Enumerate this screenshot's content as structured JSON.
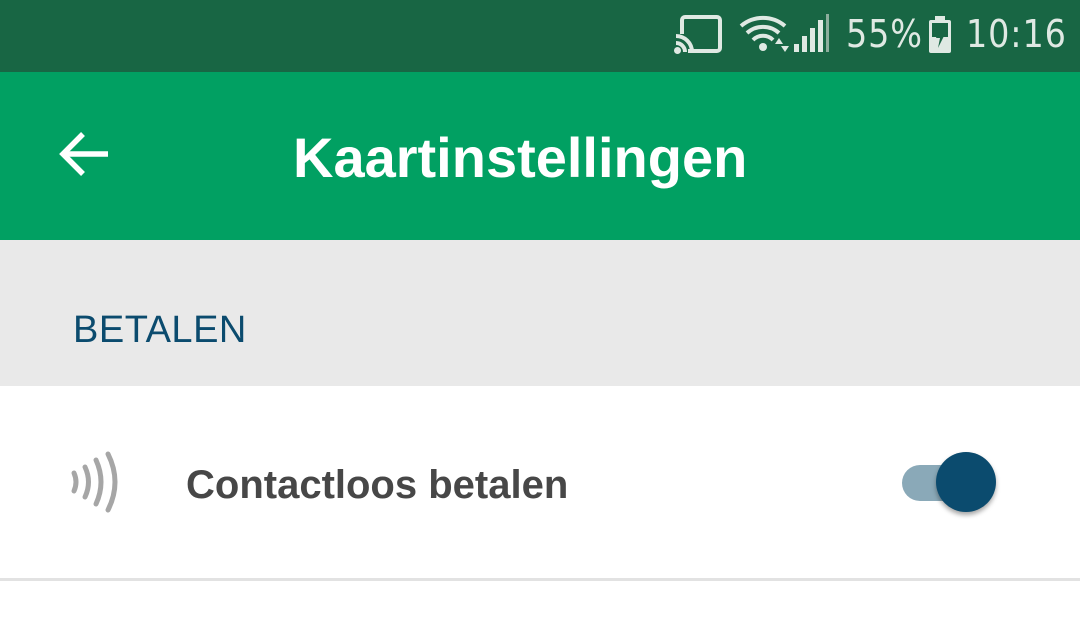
{
  "status_bar": {
    "battery_percent": "55%",
    "time": "10:16",
    "icons": [
      "cast-icon",
      "wifi-icon",
      "signal-icon",
      "battery-charging-icon"
    ]
  },
  "app_bar": {
    "title": "Kaartinstellingen",
    "back_icon": "arrow-left-icon"
  },
  "section": {
    "label": "BETALEN"
  },
  "setting": {
    "icon": "contactless-icon",
    "label": "Contactloos betalen",
    "toggle_on": true
  },
  "colors": {
    "status_bar": "#186644",
    "app_bar": "#01a062",
    "section_bg": "#e9e9e9",
    "section_text": "#0b4b6e",
    "toggle_thumb": "#0b4b6e",
    "toggle_track": "#8aa9b8"
  }
}
